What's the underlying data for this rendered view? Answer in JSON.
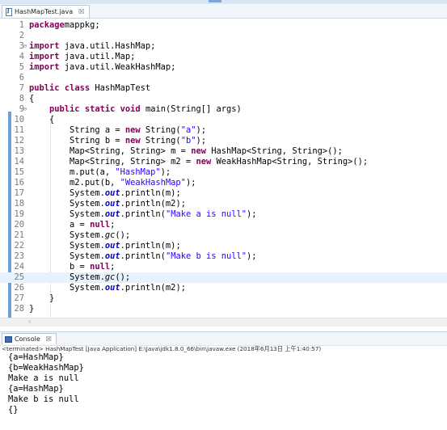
{
  "editor_tab": {
    "title": "HashMapTest.java",
    "close_glyph": "☒"
  },
  "code_lines": [
    {
      "n": "1",
      "t": [
        [
          "kw",
          "package"
        ],
        [
          "",
          "mappkg;"
        ]
      ]
    },
    {
      "n": "2",
      "t": []
    },
    {
      "n": "3",
      "fold": "⊖",
      "t": [
        [
          "kw",
          "import"
        ],
        [
          "",
          " java.util.HashMap;"
        ]
      ]
    },
    {
      "n": "4",
      "t": [
        [
          "kw",
          "import"
        ],
        [
          "",
          " java.util.Map;"
        ]
      ]
    },
    {
      "n": "5",
      "t": [
        [
          "kw",
          "import"
        ],
        [
          "",
          " java.util.WeakHashMap;"
        ]
      ]
    },
    {
      "n": "6",
      "t": []
    },
    {
      "n": "7",
      "t": [
        [
          "kw",
          "public"
        ],
        [
          "",
          " "
        ],
        [
          "kw",
          "class"
        ],
        [
          "",
          " HashMapTest"
        ]
      ]
    },
    {
      "n": "8",
      "t": [
        [
          "",
          "{"
        ]
      ]
    },
    {
      "n": "9",
      "fold": "⊖",
      "t": [
        [
          "",
          "    "
        ],
        [
          "kw",
          "public"
        ],
        [
          "",
          " "
        ],
        [
          "kw",
          "static"
        ],
        [
          "",
          " "
        ],
        [
          "kw",
          "void"
        ],
        [
          "",
          " main(String[] args)"
        ]
      ]
    },
    {
      "n": "10",
      "t": [
        [
          "",
          "    {"
        ]
      ]
    },
    {
      "n": "11",
      "t": [
        [
          "",
          "        String a = "
        ],
        [
          "kw",
          "new"
        ],
        [
          "",
          " String("
        ],
        [
          "st",
          "\"a\""
        ],
        [
          "",
          ");"
        ]
      ]
    },
    {
      "n": "12",
      "t": [
        [
          "",
          "        String b = "
        ],
        [
          "kw",
          "new"
        ],
        [
          "",
          " String("
        ],
        [
          "st",
          "\"b\""
        ],
        [
          "",
          ");"
        ]
      ]
    },
    {
      "n": "13",
      "t": [
        [
          "",
          "        Map<String, String> m = "
        ],
        [
          "kw",
          "new"
        ],
        [
          "",
          " HashMap<String, String>();"
        ]
      ]
    },
    {
      "n": "14",
      "t": [
        [
          "",
          "        Map<String, String> m2 = "
        ],
        [
          "kw",
          "new"
        ],
        [
          "",
          " WeakHashMap<String, String>();"
        ]
      ]
    },
    {
      "n": "15",
      "t": [
        [
          "",
          "        m.put(a, "
        ],
        [
          "st",
          "\"HashMap\""
        ],
        [
          "",
          ");"
        ]
      ]
    },
    {
      "n": "16",
      "t": [
        [
          "",
          "        m2.put(b, "
        ],
        [
          "st",
          "\"WeakHashMap\""
        ],
        [
          "",
          ");"
        ]
      ]
    },
    {
      "n": "17",
      "t": [
        [
          "",
          "        System."
        ],
        [
          "fld",
          "out"
        ],
        [
          "",
          ".println(m);"
        ]
      ]
    },
    {
      "n": "18",
      "t": [
        [
          "",
          "        System."
        ],
        [
          "fld",
          "out"
        ],
        [
          "",
          ".println(m2);"
        ]
      ]
    },
    {
      "n": "19",
      "t": [
        [
          "",
          "        System."
        ],
        [
          "fld",
          "out"
        ],
        [
          "",
          ".println("
        ],
        [
          "st",
          "\"Make a is null\""
        ],
        [
          "",
          ");"
        ]
      ]
    },
    {
      "n": "20",
      "t": [
        [
          "",
          "        a = "
        ],
        [
          "kw",
          "null"
        ],
        [
          "",
          ";"
        ]
      ]
    },
    {
      "n": "21",
      "t": [
        [
          "",
          "        System."
        ],
        [
          "it",
          "gc"
        ],
        [
          "",
          "();"
        ]
      ]
    },
    {
      "n": "22",
      "t": [
        [
          "",
          "        System."
        ],
        [
          "fld",
          "out"
        ],
        [
          "",
          ".println(m);"
        ]
      ]
    },
    {
      "n": "23",
      "t": [
        [
          "",
          "        System."
        ],
        [
          "fld",
          "out"
        ],
        [
          "",
          ".println("
        ],
        [
          "st",
          "\"Make b is null\""
        ],
        [
          "",
          ");"
        ]
      ]
    },
    {
      "n": "24",
      "t": [
        [
          "",
          "        b = "
        ],
        [
          "kw",
          "null"
        ],
        [
          "",
          ";"
        ]
      ]
    },
    {
      "n": "25",
      "cur": true,
      "t": [
        [
          "",
          "        System."
        ],
        [
          "it",
          "gc"
        ],
        [
          "",
          "();"
        ]
      ]
    },
    {
      "n": "26",
      "t": [
        [
          "",
          "        System."
        ],
        [
          "fld",
          "out"
        ],
        [
          "",
          ".println(m2);"
        ]
      ]
    },
    {
      "n": "27",
      "t": [
        [
          "",
          "    }"
        ]
      ]
    },
    {
      "n": "28",
      "t": [
        [
          "",
          "}"
        ]
      ]
    }
  ],
  "scroll_arrow": "‹",
  "console": {
    "tab_title": "Console",
    "close_glyph": "☒",
    "status": "<terminated> HashMapTest [Java Application] E:\\Java\\jdk1.8.0_66\\bin\\javaw.exe (2018年6月13日 上午1:40:57)",
    "output": [
      "{a=HashMap}",
      "{b=WeakHashMap}",
      "Make a is null",
      "{a=HashMap}",
      "Make b is null",
      "{}"
    ]
  }
}
